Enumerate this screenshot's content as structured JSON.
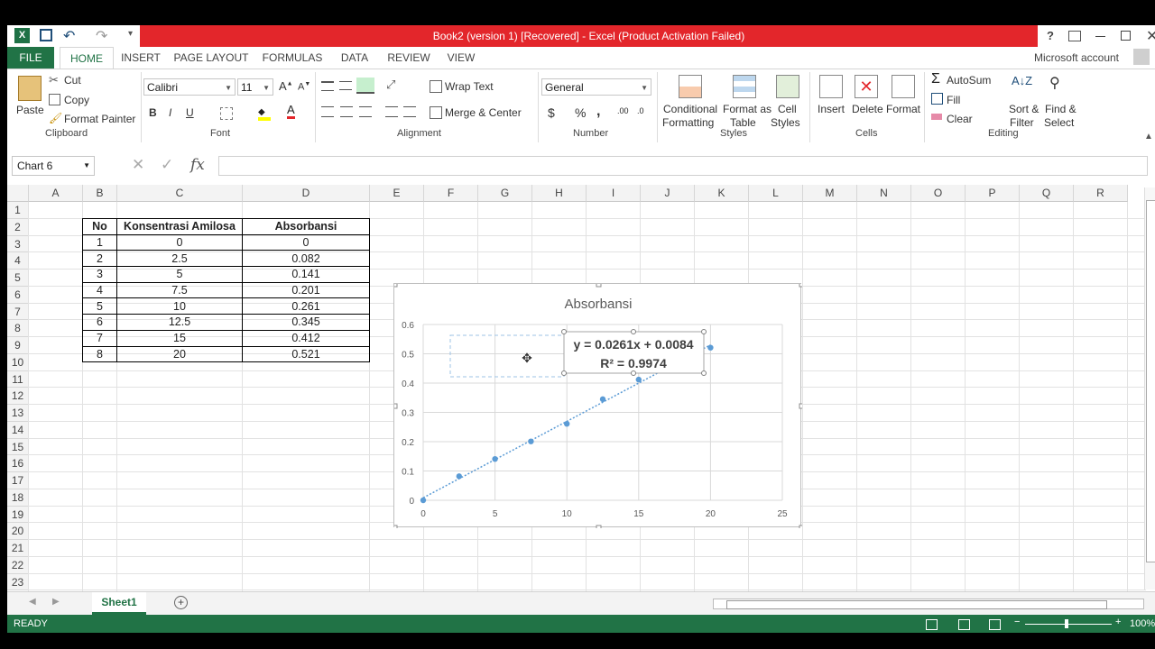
{
  "window": {
    "title": "Book2 (version 1) [Recovered] -  Excel (Product Activation Failed)",
    "help": "?",
    "account": "Microsoft account"
  },
  "ribbon": {
    "tabs": [
      "FILE",
      "HOME",
      "INSERT",
      "PAGE LAYOUT",
      "FORMULAS",
      "DATA",
      "REVIEW",
      "VIEW"
    ],
    "clipboard": {
      "paste": "Paste",
      "cut": "Cut",
      "copy": "Copy",
      "format_painter": "Format Painter",
      "group": "Clipboard"
    },
    "font": {
      "name": "Calibri",
      "size": "11",
      "group": "Font",
      "bold": "B",
      "italic": "I",
      "underline": "U"
    },
    "alignment": {
      "wrap": "Wrap Text",
      "merge": "Merge & Center",
      "group": "Alignment"
    },
    "number": {
      "format": "General",
      "currency": "$",
      "percent": "%",
      "comma": ",",
      "group": "Number"
    },
    "styles": {
      "conditional": "Conditional",
      "formatting": "Formatting",
      "format_as": "Format as",
      "table": "Table",
      "cell": "Cell",
      "cell_styles": "Styles",
      "group": "Styles"
    },
    "cells": {
      "insert": "Insert",
      "delete": "Delete",
      "format": "Format",
      "group": "Cells"
    },
    "editing": {
      "autosum": "AutoSum",
      "fill": "Fill",
      "clear": "Clear",
      "sort": "Sort &",
      "filter": "Filter",
      "find": "Find &",
      "select": "Select",
      "group": "Editing"
    }
  },
  "formula_bar": {
    "name_box": "Chart 6",
    "fx": "fx",
    "value": ""
  },
  "columns": [
    "A",
    "B",
    "C",
    "D",
    "E",
    "F",
    "G",
    "H",
    "I",
    "J",
    "K",
    "L",
    "M",
    "N",
    "O",
    "P",
    "Q",
    "R"
  ],
  "rows": [
    "1",
    "2",
    "3",
    "4",
    "5",
    "6",
    "7",
    "8",
    "9",
    "10",
    "11",
    "12",
    "13",
    "14",
    "15",
    "16",
    "17",
    "18",
    "19",
    "20",
    "21",
    "22",
    "23"
  ],
  "table": {
    "headers": [
      "No",
      "Konsentrasi Amilosa",
      "Absorbansi"
    ],
    "rows": [
      [
        "1",
        "0",
        "0"
      ],
      [
        "2",
        "2.5",
        "0.082"
      ],
      [
        "3",
        "5",
        "0.141"
      ],
      [
        "4",
        "7.5",
        "0.201"
      ],
      [
        "5",
        "10",
        "0.261"
      ],
      [
        "6",
        "12.5",
        "0.345"
      ],
      [
        "7",
        "15",
        "0.412"
      ],
      [
        "8",
        "20",
        "0.521"
      ]
    ]
  },
  "chart_data": {
    "type": "scatter",
    "title": "Absorbansi",
    "x": [
      0,
      2.5,
      5,
      7.5,
      10,
      12.5,
      15,
      20
    ],
    "y": [
      0,
      0.082,
      0.141,
      0.201,
      0.261,
      0.345,
      0.412,
      0.521
    ],
    "xlim": [
      0,
      25
    ],
    "ylim": [
      0,
      0.6
    ],
    "xticks": [
      "0",
      "5",
      "10",
      "15",
      "20",
      "25"
    ],
    "yticks": [
      "0",
      "0.1",
      "0.2",
      "0.3",
      "0.4",
      "0.5",
      "0.6"
    ],
    "trendline": {
      "type": "linear",
      "slope": 0.0261,
      "intercept": 0.0084
    },
    "equation": "y = 0.0261x + 0.0084",
    "r_squared": "R² = 0.9974",
    "grid": true,
    "series_color": "#5b9bd5"
  },
  "sheet_tabs": [
    "Sheet1"
  ],
  "status": {
    "ready": "READY",
    "zoom": "100%"
  },
  "colors": {
    "excel_green": "#217346",
    "title_red": "#e3262b"
  }
}
